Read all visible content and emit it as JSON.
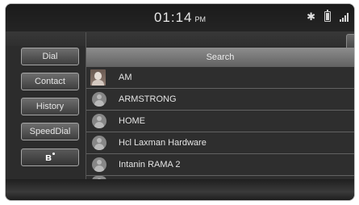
{
  "status_bar": {
    "time": "01:14",
    "ampm": "PM",
    "icons": [
      "bluetooth-icon",
      "battery-icon",
      "signal-icon"
    ]
  },
  "sidebar": {
    "items": [
      {
        "label": "Dial"
      },
      {
        "label": "Contact"
      },
      {
        "label": "History"
      },
      {
        "label": "SpeedDial"
      },
      {
        "label": "",
        "icon": "bluetooth-icon"
      }
    ]
  },
  "search": {
    "label": "Search"
  },
  "contacts": [
    {
      "name": "AM",
      "avatar": "photo"
    },
    {
      "name": "ARMSTRONG",
      "avatar": "default"
    },
    {
      "name": "HOME",
      "avatar": "default"
    },
    {
      "name": "Hcl Laxman Hardware",
      "avatar": "default"
    },
    {
      "name": "Intanin RAMA 2",
      "avatar": "default"
    }
  ],
  "colors": {
    "screen_bg": "#2c2c2c",
    "button_border": "#a5a5a5",
    "text": "#e4e4e4"
  }
}
